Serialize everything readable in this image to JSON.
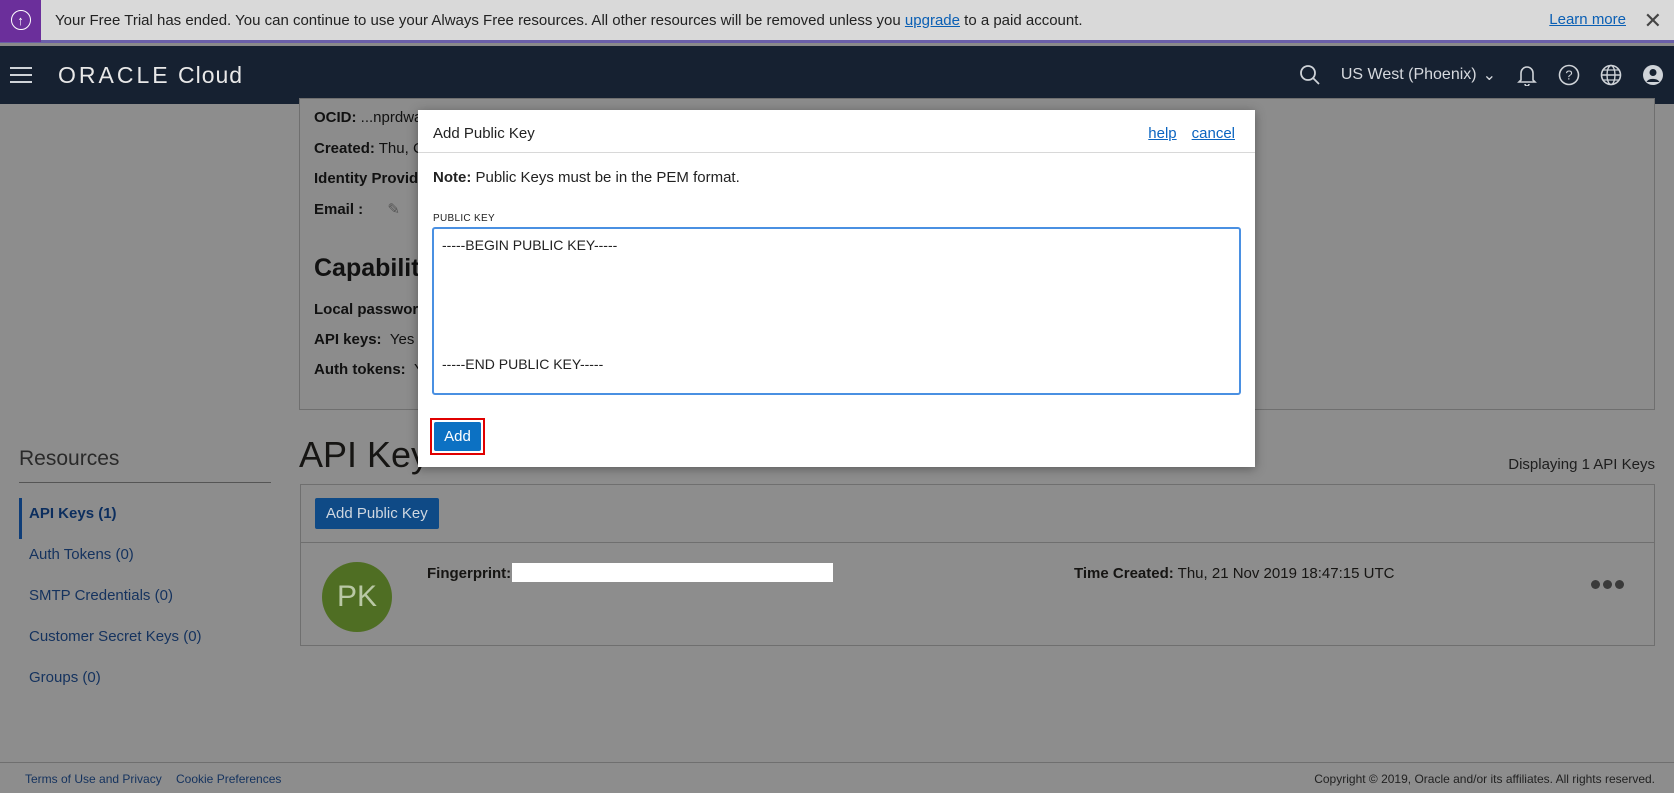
{
  "banner": {
    "text_before": "Your Free Trial has ended. You can continue to use your Always Free resources. All other resources will be removed unless you ",
    "upgrade_link": "upgrade",
    "text_after": " to a paid account.",
    "learn_more": "Learn more"
  },
  "header": {
    "logo_brand": "ORACLE",
    "logo_product": "Cloud",
    "region": "US West (Phoenix)"
  },
  "user_details": {
    "ocid_label": "OCID:",
    "ocid_value": "...nprdwa",
    "created_label": "Created:",
    "created_value": "Thu, C",
    "identity_label": "Identity Provide",
    "email_label": "Email :"
  },
  "capabilities": {
    "title": "Capabiliti",
    "local_password_label": "Local passworc",
    "api_keys_label": "API keys:",
    "api_keys_value": "Yes",
    "auth_tokens_label": "Auth tokens:",
    "auth_tokens_value": "Y"
  },
  "resources": {
    "title": "Resources",
    "items": [
      {
        "label": "API Keys (1)"
      },
      {
        "label": "Auth Tokens (0)"
      },
      {
        "label": "SMTP Credentials (0)"
      },
      {
        "label": "Customer Secret Keys (0)"
      },
      {
        "label": "Groups (0)"
      }
    ]
  },
  "api_keys": {
    "title": "API Key",
    "displaying": "Displaying 1 API Keys",
    "add_button": "Add Public Key",
    "avatar_initials": "PK",
    "fingerprint_label": "Fingerprint:",
    "time_created_label": "Time Created:",
    "time_created_value": "Thu, 21 Nov 2019 18:47:15 UTC"
  },
  "footer": {
    "terms": "Terms of Use and Privacy",
    "cookies": "Cookie Preferences",
    "copyright": "Copyright © 2019, Oracle and/or its affiliates. All rights reserved."
  },
  "dialog": {
    "title": "Add Public Key",
    "help": "help",
    "cancel": "cancel",
    "note_label": "Note:",
    "note_text": " Public Keys must be in the PEM format.",
    "public_key_label": "PUBLIC KEY",
    "public_key_value": "-----BEGIN PUBLIC KEY-----\n\n\n\n\n\n\n-----END PUBLIC KEY-----",
    "add_button": "Add"
  }
}
